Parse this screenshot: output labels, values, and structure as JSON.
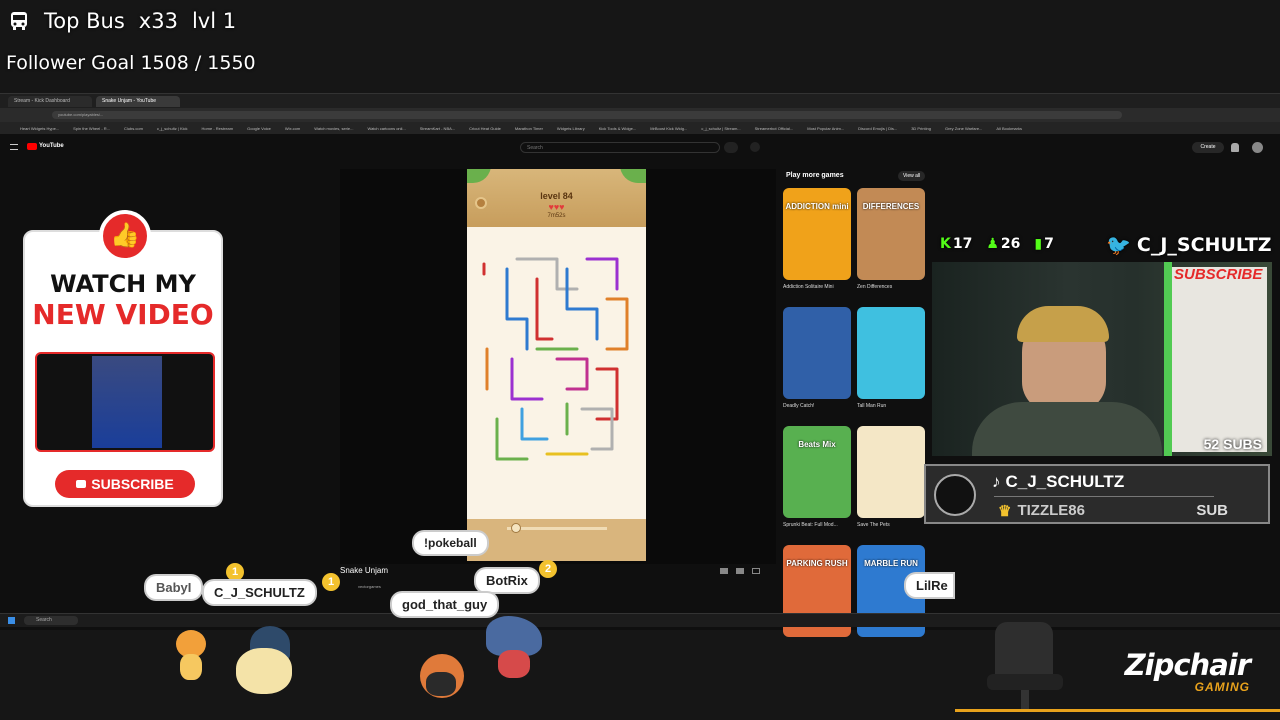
{
  "overlay": {
    "top_bus_label": "Top Bus",
    "top_bus_count": "x33",
    "top_bus_level": "lvl 1",
    "follower_goal": "Follower Goal 1508 / 1550"
  },
  "browser": {
    "tabs": [
      "Stream - Kick Dashboard",
      "Snake Unjam - YouTube"
    ],
    "url": "youtube.com/playables/...",
    "bookmarks": [
      "Heart Widgets Hype...",
      "Spin the Wheel - R...",
      "Clubs.com",
      "c_j_schultz | Kick",
      "Home - Restream",
      "Google Voice",
      "Wix.com",
      "Watch movies, serie...",
      "Watch cartoons onli...",
      "StreamKart - NBA...",
      "Cricut Heat Guide",
      "Marathon Timer",
      "Widgets Library",
      "Kick Tools & Widge...",
      "MrBoost Kick Widg...",
      "c_j_schultz | Stream...",
      "Streamerbot Official...",
      "Most Popular Anim...",
      "Discord Emojis | Dis...",
      "3D Printing",
      "Grey Zone Warfare...",
      "All Bookmarks"
    ],
    "youtube_logo": "YouTube",
    "search_placeholder": "Search",
    "create_label": "Create"
  },
  "game": {
    "level": "level 84",
    "timer": "7m52s",
    "title": "Snake Unjam",
    "channel": "vectorgames"
  },
  "side": {
    "heading": "Play more games",
    "view_all": "View all",
    "games": [
      {
        "title": "Addiction Solitaire Mini",
        "art": "ADDICTION mini",
        "color": "#f0a21a"
      },
      {
        "title": "Zen Differences",
        "art": "DIFFERENCES",
        "color": "#c28a55"
      },
      {
        "title": "Deadly Catch!",
        "art": "",
        "color": "#3060a8"
      },
      {
        "title": "Tall Man Run",
        "art": "",
        "color": "#3fc0e0"
      },
      {
        "title": "Sprunki Beat: Full Mod...",
        "art": "Beats Mix",
        "color": "#58b050"
      },
      {
        "title": "Save The Pets",
        "art": "",
        "color": "#f4e7c6"
      },
      {
        "title": "",
        "art": "PARKING RUSH",
        "color": "#e06a3a"
      },
      {
        "title": "",
        "art": "MARBLE RUN",
        "color": "#2e7ad0"
      }
    ]
  },
  "promo": {
    "line1": "WATCH MY",
    "line2": "NEW VIDEO",
    "subscribe": "SUBSCRIBE"
  },
  "stats": {
    "kick": "17",
    "followers": "26",
    "bars": "7",
    "twitter_handle": "C_J_SCHULTZ",
    "subs": "52 SUBS",
    "subscribe_sign": "SUBSCRIBE"
  },
  "alert": {
    "name": "C_J_SCHULTZ",
    "sub_name": "TIZZLE86",
    "type": "SUB"
  },
  "chat": {
    "pokeball": "!pokeball",
    "bubbles": [
      "BabyI",
      "C_J_SCHULTZ",
      "BotRix",
      "god_that_guy",
      "LilRe"
    ],
    "badge1": "1",
    "badge2": "2"
  },
  "sponsor": {
    "brand": "Zipchair",
    "sub": "GAMING"
  },
  "taskbar": {
    "search": "Search"
  }
}
